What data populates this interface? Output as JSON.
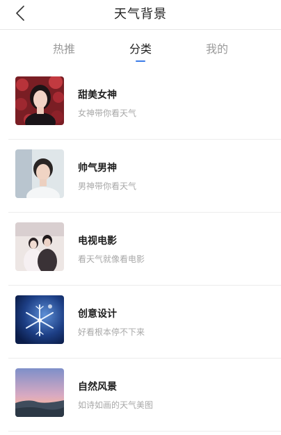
{
  "header": {
    "title": "天气背景",
    "back_icon": "chevron-left-icon"
  },
  "tabs": [
    {
      "label": "热推",
      "active": false
    },
    {
      "label": "分类",
      "active": true
    },
    {
      "label": "我的",
      "active": false
    }
  ],
  "colors": {
    "accent": "#3a7be8",
    "muted": "#a8a8a8",
    "tab_inactive": "#9a9a9a"
  },
  "categories": [
    {
      "title": "甜美女神",
      "subtitle": "女神带你看天气",
      "image": "portrait-woman-roses"
    },
    {
      "title": "帅气男神",
      "subtitle": "男神带你看天气",
      "image": "portrait-man"
    },
    {
      "title": "电视电影",
      "subtitle": "看天气就像看电影",
      "image": "film-couple-still"
    },
    {
      "title": "创意设计",
      "subtitle": "好看根本停不下来",
      "image": "snowflake-art"
    },
    {
      "title": "自然风景",
      "subtitle": "如诗如画的天气美图",
      "image": "sunset-landscape"
    }
  ]
}
